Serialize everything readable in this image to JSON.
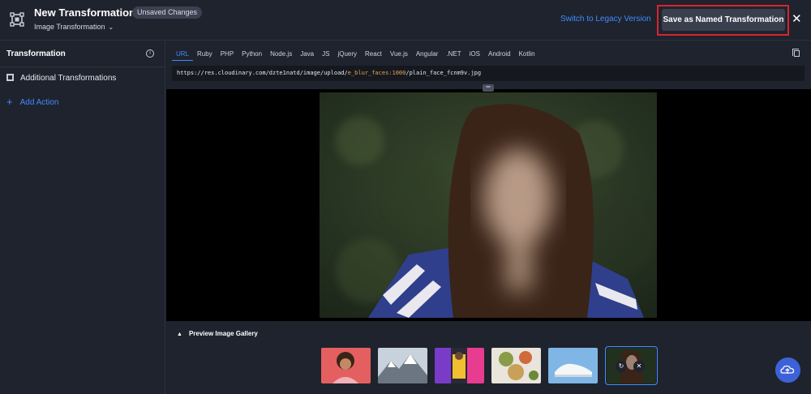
{
  "header": {
    "title": "New Transformation",
    "badge": "Unsaved Changes",
    "subtitle": "Image Transformation",
    "legacy_link": "Switch to Legacy Version",
    "save_label": "Save as Named Transformation",
    "close_glyph": "✕"
  },
  "sidebar": {
    "heading": "Transformation",
    "items": [
      {
        "label": "Additional Transformations",
        "icon": "square-icon"
      }
    ],
    "add_action": "Add Action"
  },
  "code": {
    "tabs": [
      "URL",
      "Ruby",
      "PHP",
      "Python",
      "Node.js",
      "Java",
      "JS",
      "jQuery",
      "React",
      "Vue.js",
      "Angular",
      ".NET",
      "iOS",
      "Android",
      "Kotlin"
    ],
    "active_tab": "URL",
    "url_prefix": "https://res.cloudinary.com/dzte1natd/image/upload/",
    "url_param": "e_blur_faces:1000",
    "url_file": "/plain_face_fcnm9v.jpg"
  },
  "gallery": {
    "label": "Preview Image Gallery",
    "thumbnails": [
      "woman-curly-hair",
      "snowy-mountains",
      "colorful-fashion",
      "food-plates",
      "white-sneaker",
      "blurred-face-woman"
    ],
    "selected_index": 5
  },
  "colors": {
    "accent": "#3f8cff",
    "highlight": "#d8242f",
    "url_param": "#e8a65a"
  }
}
